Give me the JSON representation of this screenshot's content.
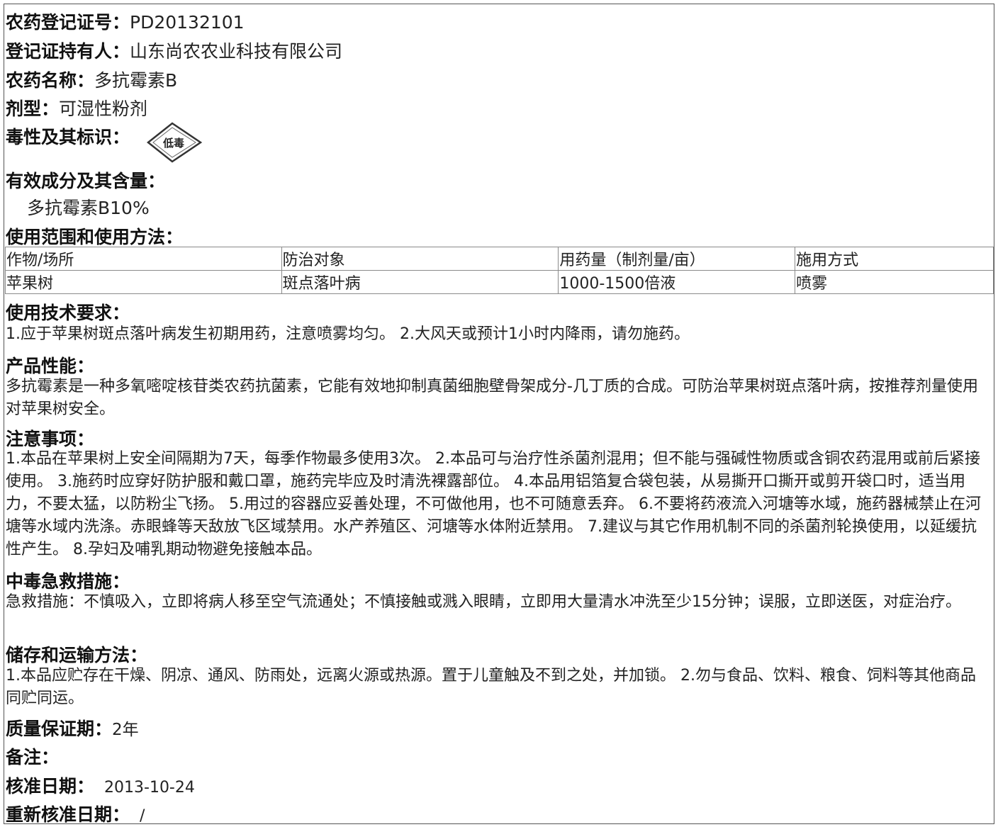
{
  "reg_no": {
    "label": "农药登记证号：",
    "value": "PD20132101"
  },
  "holder": {
    "label": "登记证持有人：",
    "value": "山东尚农农业科技有限公司"
  },
  "name": {
    "label": "农药名称：",
    "value": "多抗霉素B"
  },
  "formulation": {
    "label": "剂型：",
    "value": "可湿性粉剂"
  },
  "toxicity": {
    "label": "毒性及其标识：",
    "badge_text": "低毒",
    "badge_icon": "low-toxicity-diamond-icon"
  },
  "ingredients": {
    "label": "有效成分及其含量：",
    "value": "多抗霉素B10%"
  },
  "usage": {
    "label": "使用范围和使用方法：",
    "headers": [
      "作物/场所",
      "防治对象",
      "用药量（制剂量/亩）",
      "施用方式"
    ],
    "rows": [
      [
        "苹果树",
        "斑点落叶病",
        "1000-1500倍液",
        "喷雾"
      ]
    ]
  },
  "tech": {
    "label": "使用技术要求：",
    "text": "1.应于苹果树斑点落叶病发生初期用药，注意喷雾均匀。 2.大风天或预计1小时内降雨，请勿施药。"
  },
  "performance": {
    "label": "产品性能：",
    "text": "多抗霉素是一种多氧嘧啶核苷类农药抗菌素，它能有效地抑制真菌细胞壁骨架成分-几丁质的合成。可防治苹果树斑点落叶病，按推荐剂量使用对苹果树安全。"
  },
  "notes": {
    "label": "注意事项：",
    "text": "1.本品在苹果树上安全间隔期为7天，每季作物最多使用3次。 2.本品可与治疗性杀菌剂混用；但不能与强碱性物质或含铜农药混用或前后紧接使用。 3.施药时应穿好防护服和戴口罩，施药完毕应及时清洗裸露部位。 4.本品用铝箔复合袋包装，从易撕开口撕开或剪开袋口时，适当用力，不要太猛，以防粉尘飞扬。 5.用过的容器应妥善处理，不可做他用，也不可随意丢弃。 6.不要将药液流入河塘等水域，施药器械禁止在河塘等水域内洗涤。赤眼蜂等天敌放飞区域禁用。水产养殖区、河塘等水体附近禁用。 7.建议与其它作用机制不同的杀菌剂轮换使用，以延缓抗性产生。 8.孕妇及哺乳期动物避免接触本品。"
  },
  "first_aid": {
    "label": "中毒急救措施：",
    "text": "急救措施：不慎吸入，立即将病人移至空气流通处；不慎接触或溅入眼睛，立即用大量清水冲洗至少15分钟；误服，立即送医，对症治疗。"
  },
  "storage": {
    "label": "储存和运输方法：",
    "text": "1.本品应贮存在干燥、阴凉、通风、防雨处，远离火源或热源。置于儿童触及不到之处，并加锁。 2.勿与食品、饮料、粮食、饲料等其他商品同贮同运。"
  },
  "shelf_life": {
    "label": "质量保证期：",
    "value": "2年"
  },
  "remarks": {
    "label": "备注："
  },
  "approval_date": {
    "label": "核准日期：",
    "value": "2013-10-24"
  },
  "reapproval_date": {
    "label": "重新核准日期：",
    "value": "/"
  }
}
